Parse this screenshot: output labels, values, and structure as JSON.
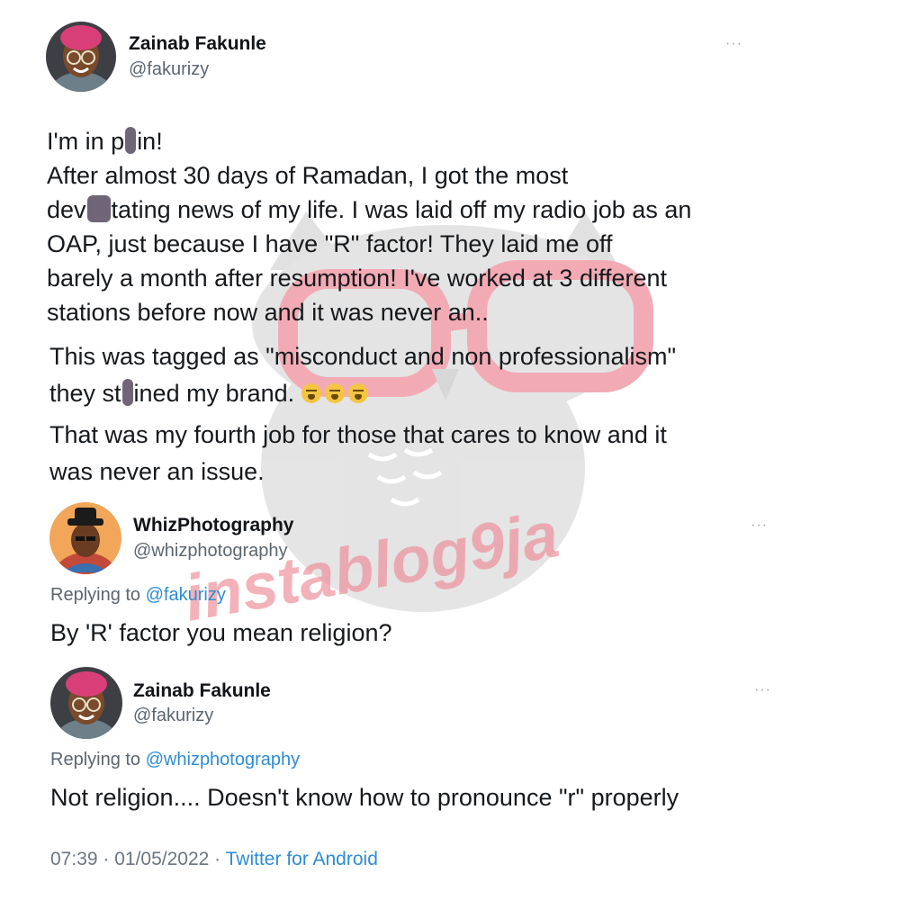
{
  "tweets": [
    {
      "name": "Zainab Fakunle",
      "handle": "@fakurizy",
      "more": "···"
    },
    {
      "name": "WhizPhotography",
      "handle": "@whizphotography",
      "more": "···",
      "reply_prefix": "Replying to",
      "reply_to": "@fakurizy",
      "text": "By 'R' factor you mean religion?"
    },
    {
      "name": "Zainab Fakunle",
      "handle": "@fakurizy",
      "more": "···",
      "reply_prefix": "Replying to",
      "reply_to": "@whizphotography",
      "text": "Not religion.... Doesn't know how to pronounce \"r\" properly"
    }
  ],
  "main_text": {
    "l1_a": "I'm in p",
    "l1_b": "in!",
    "l2": "After almost 30 days of Ramadan, I got the most",
    "l3_a": "dev",
    "l3_b": "tating news of my life. I was laid off my radio job as an",
    "l4": "OAP,  just because I have \"R\" factor! They laid me off",
    "l5": "barely a month after resumption! I've worked at 3 different",
    "l6": "stations before now and it was never an..",
    "l7": "This was tagged as \"misconduct and non professionalism\"",
    "l8_a": "they st",
    "l8_b": "ined my brand.",
    "l9": "That was my fourth job for those that cares to know and it",
    "l10": "was never an issue."
  },
  "emoji": [
    "crying-face",
    "crying-face",
    "crying-face"
  ],
  "footer": {
    "time": "07:39",
    "sep1": " · ",
    "date": "01/05/2022",
    "sep2": " · ",
    "source": "Twitter for Android"
  },
  "watermark": {
    "text": "instablog9ja",
    "colors": {
      "owl": "#cfcfcf",
      "glasses": "#e8687a",
      "text": "#ee8a96"
    }
  }
}
